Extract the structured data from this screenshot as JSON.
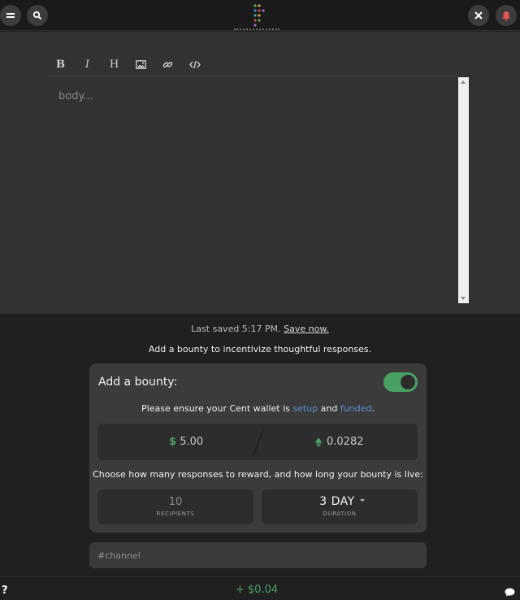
{
  "topbar": {
    "menu_icon": "hamburger-icon",
    "search_icon": "search-icon",
    "close_icon": "close-icon",
    "notification_icon": "bell-icon",
    "logo_colors": [
      "#6aa84f",
      "#e0a040",
      "#4a86c8",
      "#c05050",
      "#9a6ac8",
      "#50a0a0"
    ]
  },
  "editor": {
    "toolbar": {
      "bold": "B",
      "italic": "I",
      "heading": "H",
      "image_icon": "image-icon",
      "link_icon": "link-icon",
      "code_icon": "code-icon"
    },
    "body_placeholder": "body..."
  },
  "status": {
    "saved_text": "Last saved 5:17 PM.",
    "save_now": "Save now.",
    "prompt": "Add a bounty to incentivize thoughtful responses."
  },
  "bounty": {
    "title": "Add a bounty:",
    "enabled": true,
    "wallet_note_prefix": "Please ensure your Cent wallet is",
    "setup_link": "setup",
    "and_text": "and",
    "funded_link": "funded",
    "period": ".",
    "usd_symbol": "$",
    "usd_amount": "5.00",
    "eth_amount": "0.0282",
    "choose_text": "Choose how many responses to reward, and how long your bounty is live:",
    "recipients_value": "10",
    "recipients_label": "RECIPIENTS",
    "duration_value": "3 DAY",
    "duration_label": "DURATION"
  },
  "channel": {
    "placeholder": "#channel"
  },
  "footer": {
    "help": "?",
    "balance": "+ $0.04",
    "chat_icon": "chat-icon"
  },
  "colors": {
    "accent_green": "#4aa064",
    "link_blue": "#5b8fcf",
    "bell_red": "#e05555"
  }
}
